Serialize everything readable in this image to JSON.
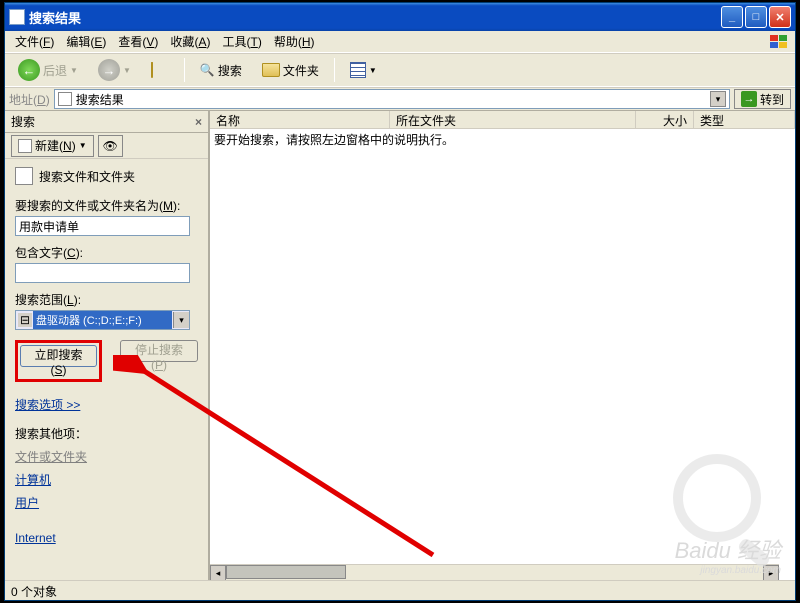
{
  "window": {
    "title": "搜索结果"
  },
  "menus": {
    "file": "文件",
    "file_u": "F",
    "edit": "编辑",
    "edit_u": "E",
    "view": "查看",
    "view_u": "V",
    "fav": "收藏",
    "fav_u": "A",
    "tools": "工具",
    "tools_u": "T",
    "help": "帮助",
    "help_u": "H"
  },
  "toolbar": {
    "back": "后退",
    "search": "搜索",
    "folders": "文件夹"
  },
  "addressbar": {
    "label": "地址",
    "label_u": "D",
    "value": "搜索结果",
    "go": "转到"
  },
  "sidebar": {
    "title": "搜索",
    "new": "新建",
    "new_u": "N",
    "section": "搜索文件和文件夹",
    "name_label": "要搜索的文件或文件夹名为",
    "name_u": "M",
    "name_value": "用款申请单",
    "text_label": "包含文字",
    "text_u": "C",
    "text_value": "",
    "scope_label": "搜索范围",
    "scope_u": "L",
    "scope_value": "盘驱动器 (C:;D:;E:;F:)",
    "search_now": "立即搜索",
    "search_now_u": "S",
    "stop": "停止搜索",
    "stop_u": "P",
    "options": "搜索选项 >>",
    "other_heading": "搜索其他项：",
    "other": {
      "files": "文件或文件夹",
      "computer": "计算机",
      "user": "用户",
      "internet": "Internet"
    }
  },
  "columns": {
    "name": "名称",
    "folder": "所在文件夹",
    "size": "大小",
    "type": "类型"
  },
  "main_message": "要开始搜索，请按照左边窗格中的说明执行。",
  "statusbar": {
    "objects": "0 个对象"
  },
  "watermark": {
    "brand": "Baidu 经验",
    "sub": "jingyan.baidu.com"
  }
}
